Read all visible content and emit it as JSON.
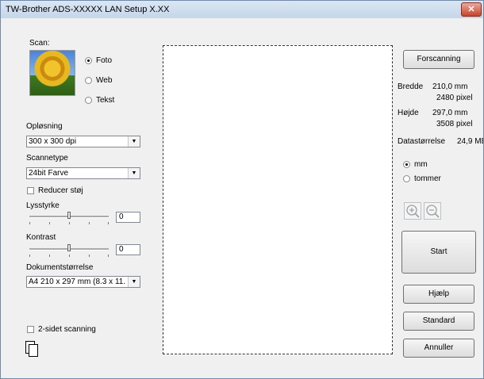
{
  "window": {
    "title": "TW-Brother ADS-XXXXX LAN Setup X.XX",
    "close_glyph": "✕"
  },
  "scan": {
    "label": "Scan:",
    "options": [
      "Foto",
      "Web",
      "Tekst"
    ],
    "selected": "Foto"
  },
  "resolution": {
    "label": "Opløsning",
    "value": "300 x 300 dpi"
  },
  "scantype": {
    "label": "Scannetype",
    "value": "24bit Farve"
  },
  "noise": {
    "label": "Reducer støj",
    "checked": false
  },
  "brightness": {
    "label": "Lysstyrke",
    "value": "0"
  },
  "contrast": {
    "label": "Kontrast",
    "value": "0"
  },
  "docsize": {
    "label": "Dokumentstørrelse",
    "value": "A4 210 x 297 mm (8.3 x 11."
  },
  "duplex": {
    "label": "2-sidet scanning",
    "checked": false
  },
  "right": {
    "prescan_label": "Forscanning",
    "width_label": "Bredde",
    "width_mm": "210,0 mm",
    "width_px": "2480 pixel",
    "height_label": "Højde",
    "height_mm": "297,0 mm",
    "height_px": "3508 pixel",
    "datasize_label": "Datastørrelse",
    "datasize_value": "24,9 MB",
    "unit_options": [
      "mm",
      "tommer"
    ],
    "unit_selected": "mm",
    "start_label": "Start",
    "help_label": "Hjælp",
    "default_label": "Standard",
    "cancel_label": "Annuller"
  },
  "icons": {
    "zoom_in": "zoom-in-icon",
    "zoom_out": "zoom-out-icon",
    "photo": "photo-thumbnail-icon",
    "duplex": "duplex-pages-icon",
    "dropdown": "chevron-down-icon"
  },
  "colors": {
    "title_bar": "#c5d6ea",
    "close": "#c7442b",
    "dialog_bg": "#f0f0f0"
  }
}
